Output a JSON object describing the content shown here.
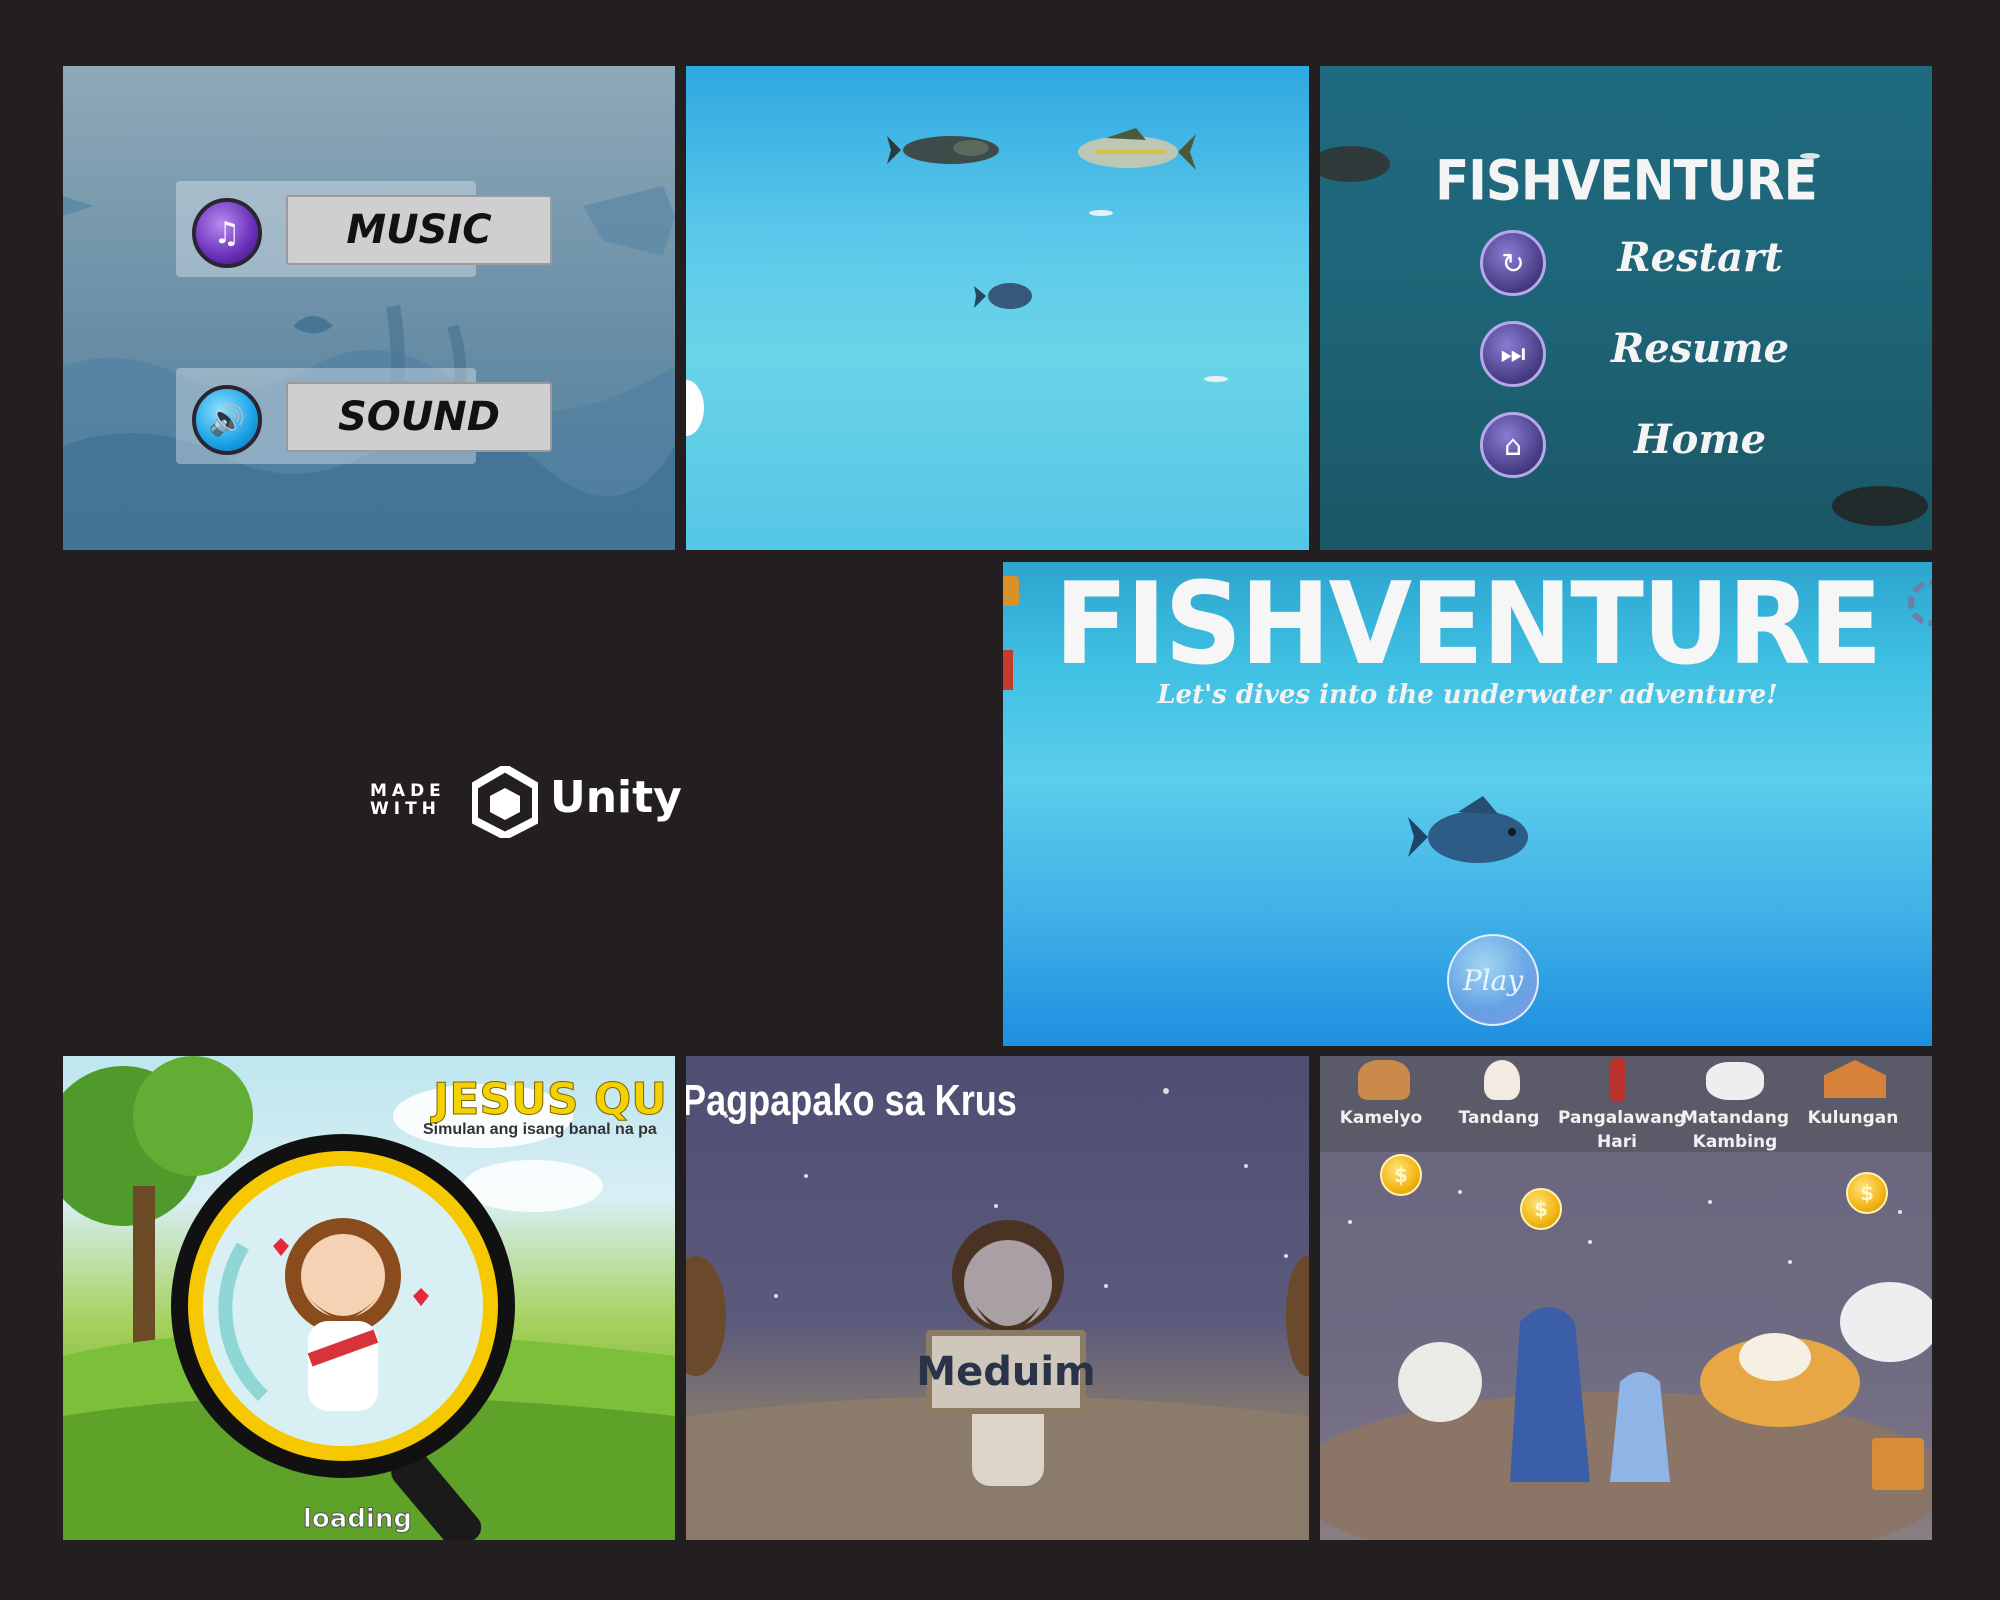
{
  "settings": {
    "music_label": "MUSIC",
    "sound_label": "SOUND",
    "music_icon": "music-note-icon",
    "sound_icon": "speaker-icon"
  },
  "pause_menu": {
    "title": "FISHVENTURE",
    "items": [
      {
        "label": "Restart",
        "icon": "restart-icon"
      },
      {
        "label": "Resume",
        "icon": "resume-icon"
      },
      {
        "label": "Home",
        "icon": "home-icon"
      }
    ]
  },
  "unity_badge": {
    "made": "MADE",
    "with": "WITH",
    "brand": "Unity"
  },
  "title_screen": {
    "title": "FISHVENTURE",
    "subtitle": "Let's dives into the underwater adventure!",
    "play_label": "Play"
  },
  "loading_screen": {
    "quiz_title": "JESUS QU",
    "quiz_subtitle": "Simulan ang isang banal na pa",
    "loading_label": "loading"
  },
  "level_screen": {
    "title": "Pagpapako sa Krus",
    "difficulty": "Meduim"
  },
  "shop": {
    "items": [
      {
        "label": "Kamelyo",
        "icon": "camel-icon"
      },
      {
        "label": "Tandang",
        "icon": "rooster-icon"
      },
      {
        "label": "Pangalawang Hari",
        "icon": "king-icon"
      },
      {
        "label": "Matandang Kambing",
        "icon": "goat-icon"
      },
      {
        "label": "Kulungan",
        "icon": "stable-icon"
      }
    ],
    "coin_symbol": "$"
  },
  "colors": {
    "background": "#231f20",
    "title_yellow": "#f4d100",
    "water_blue": "#3eaee6"
  }
}
